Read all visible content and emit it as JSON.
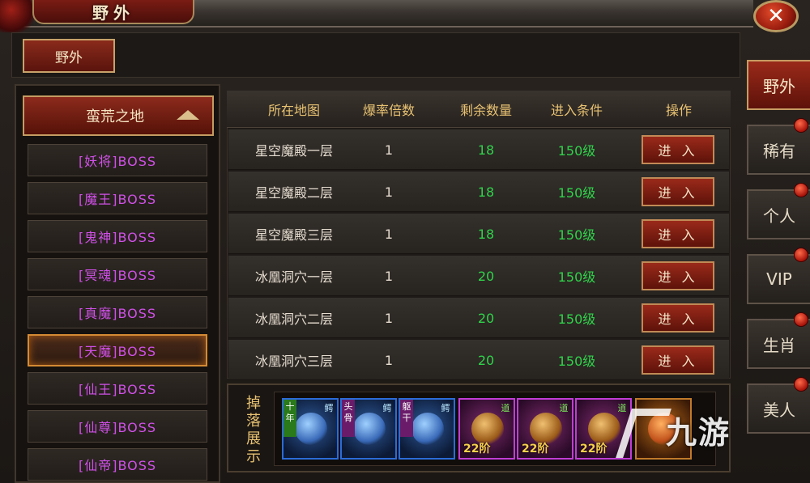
{
  "window": {
    "title": "野外",
    "close_label": "✕"
  },
  "top_tabs": [
    {
      "label": "野外"
    }
  ],
  "zone": {
    "label": "蛮荒之地"
  },
  "boss_list": [
    {
      "label": "[妖将]BOSS",
      "selected": false
    },
    {
      "label": "[魔王]BOSS",
      "selected": false
    },
    {
      "label": "[鬼神]BOSS",
      "selected": false
    },
    {
      "label": "[冥魂]BOSS",
      "selected": false
    },
    {
      "label": "[真魔]BOSS",
      "selected": false
    },
    {
      "label": "[天魔]BOSS",
      "selected": true
    },
    {
      "label": "[仙王]BOSS",
      "selected": false
    },
    {
      "label": "[仙尊]BOSS",
      "selected": false
    },
    {
      "label": "[仙帝]BOSS",
      "selected": false
    }
  ],
  "table": {
    "headers": {
      "map": "所在地图",
      "multiplier": "爆率倍数",
      "remaining": "剩余数量",
      "condition": "进入条件",
      "action": "操作"
    },
    "rows": [
      {
        "map": "星空魔殿一层",
        "multiplier": "1",
        "remaining": "18",
        "condition": "150级",
        "action": "进 入"
      },
      {
        "map": "星空魔殿二层",
        "multiplier": "1",
        "remaining": "18",
        "condition": "150级",
        "action": "进 入"
      },
      {
        "map": "星空魔殿三层",
        "multiplier": "1",
        "remaining": "18",
        "condition": "150级",
        "action": "进 入"
      },
      {
        "map": "冰凰洞穴一层",
        "multiplier": "1",
        "remaining": "20",
        "condition": "150级",
        "action": "进 入"
      },
      {
        "map": "冰凰洞穴二层",
        "multiplier": "1",
        "remaining": "20",
        "condition": "150级",
        "action": "进 入"
      },
      {
        "map": "冰凰洞穴三层",
        "multiplier": "1",
        "remaining": "20",
        "condition": "150级",
        "action": "进 入"
      }
    ]
  },
  "drops": {
    "label": "掉落展示",
    "items": [
      {
        "rarity": "blue",
        "side_tag": "十年",
        "corner_tag": "鳄",
        "level": ""
      },
      {
        "rarity": "blue",
        "side_tag": "头骨",
        "corner_tag": "鳄",
        "level": ""
      },
      {
        "rarity": "blue",
        "side_tag": "躯干",
        "corner_tag": "鳄",
        "level": ""
      },
      {
        "rarity": "purple",
        "side_tag": "",
        "corner_tag": "道",
        "level": "22阶"
      },
      {
        "rarity": "purple",
        "side_tag": "",
        "corner_tag": "道",
        "level": "22阶"
      },
      {
        "rarity": "purple",
        "side_tag": "",
        "corner_tag": "道",
        "level": "22阶"
      },
      {
        "rarity": "orange",
        "side_tag": "",
        "corner_tag": "",
        "level": ""
      }
    ]
  },
  "side_tabs": [
    {
      "label": "野外",
      "active": true
    },
    {
      "label": "稀有",
      "active": false
    },
    {
      "label": "个人",
      "active": false
    },
    {
      "label": "VIP",
      "active": false
    },
    {
      "label": "生肖",
      "active": false
    },
    {
      "label": "美人",
      "active": false
    }
  ],
  "watermark": {
    "text": "九游"
  },
  "colors": {
    "accent_red": "#8c2a1c",
    "gold_text": "#e8c272",
    "green_value": "#2fd44a",
    "boss_magenta": "#d050e8"
  }
}
